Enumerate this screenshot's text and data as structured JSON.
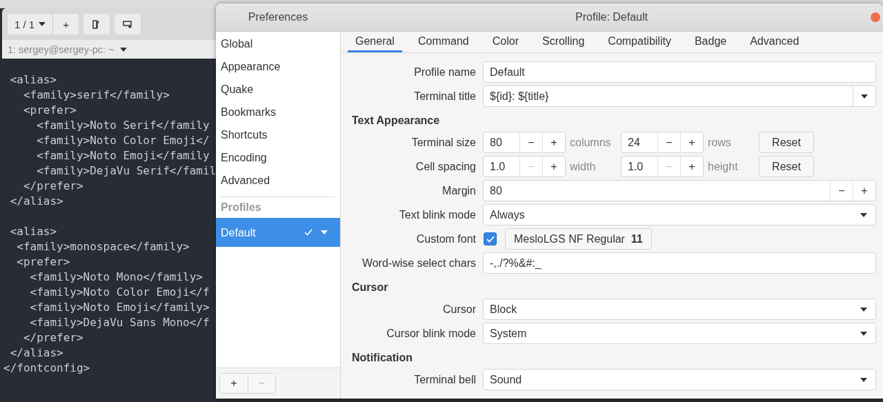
{
  "terminal": {
    "tab_counter": "1 / 1",
    "new_tab_button": "+",
    "session_title": "1: sergey@sergey-pc: ~",
    "code_blocks": [
      [
        " <alias>",
        "   <family>serif</family>",
        "   <prefer>",
        "     <family>Noto Serif</family",
        "     <family>Noto Color Emoji</",
        "     <family>Noto Emoji</family",
        "     <family>DejaVu Serif</famil",
        "   </prefer>",
        " </alias>"
      ],
      [
        " <alias>",
        "  <family>monospace</family>",
        "  <prefer>",
        "    <family>Noto Mono</family>",
        "    <family>Noto Color Emoji</f",
        "    <family>Noto Emoji</family>",
        "    <family>DejaVu Sans Mono</f",
        "   </prefer>",
        " </alias>",
        "</fontconfig>"
      ]
    ]
  },
  "preferences": {
    "title": "Preferences",
    "profile_title": "Profile: Default",
    "sidebar": {
      "items": [
        {
          "label": "Global",
          "selected": false
        },
        {
          "label": "Appearance",
          "selected": false
        },
        {
          "label": "Quake",
          "selected": false
        },
        {
          "label": "Bookmarks",
          "selected": false
        },
        {
          "label": "Shortcuts",
          "selected": false
        },
        {
          "label": "Encoding",
          "selected": false
        },
        {
          "label": "Advanced",
          "selected": false
        }
      ],
      "profiles_header": "Profiles",
      "profiles": [
        {
          "label": "Default",
          "selected": true,
          "is_default": true
        }
      ],
      "add_button": "+",
      "remove_button": "−",
      "remove_disabled": true
    },
    "tabs": [
      {
        "label": "General",
        "selected": true
      },
      {
        "label": "Command",
        "selected": false
      },
      {
        "label": "Color",
        "selected": false
      },
      {
        "label": "Scrolling",
        "selected": false
      },
      {
        "label": "Compatibility",
        "selected": false
      },
      {
        "label": "Badge",
        "selected": false
      },
      {
        "label": "Advanced",
        "selected": false
      }
    ],
    "form": [
      {
        "kind": "entry",
        "label": "Profile name",
        "value": "Default"
      },
      {
        "kind": "combo_entry",
        "label": "Terminal title",
        "value": "${id}: ${title}"
      },
      {
        "kind": "section",
        "label": "Text Appearance"
      },
      {
        "kind": "spin_pair",
        "label": "Terminal size",
        "spins": [
          {
            "value": "80",
            "minus": "−",
            "plus": "+",
            "minus_disabled": false,
            "unit": "columns"
          },
          {
            "value": "24",
            "minus": "−",
            "plus": "+",
            "minus_disabled": false,
            "unit": "rows"
          }
        ],
        "reset": "Reset"
      },
      {
        "kind": "spin_pair",
        "label": "Cell spacing",
        "spins": [
          {
            "value": "1.0",
            "minus": "−",
            "plus": "+",
            "minus_disabled": true,
            "unit": "width"
          },
          {
            "value": "1.0",
            "minus": "−",
            "plus": "+",
            "minus_disabled": true,
            "unit": "height"
          }
        ],
        "reset": "Reset"
      },
      {
        "kind": "spin_wide",
        "label": "Margin",
        "value": "80",
        "minus": "−",
        "plus": "+"
      },
      {
        "kind": "dropdown",
        "label": "Text blink mode",
        "value": "Always"
      },
      {
        "kind": "font",
        "label": "Custom font",
        "checked": true,
        "font_name": "MesloLGS NF Regular",
        "font_size": "11"
      },
      {
        "kind": "entry",
        "label": "Word-wise select chars",
        "value": "-,./?%&#:_"
      },
      {
        "kind": "section",
        "label": "Cursor"
      },
      {
        "kind": "dropdown",
        "label": "Cursor",
        "value": "Block"
      },
      {
        "kind": "dropdown",
        "label": "Cursor blink mode",
        "value": "System"
      },
      {
        "kind": "section",
        "label": "Notification"
      },
      {
        "kind": "dropdown",
        "label": "Terminal bell",
        "value": "Sound"
      }
    ]
  }
}
